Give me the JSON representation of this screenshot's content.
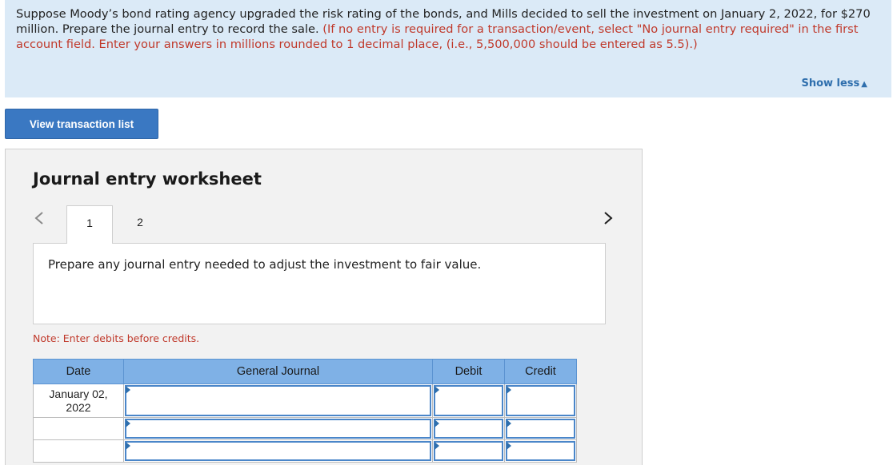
{
  "banner": {
    "text_main": "Suppose Moody’s bond rating agency upgraded the risk rating of the bonds, and Mills decided to sell the investment on January 2, 2022, for $270 million. Prepare the journal entry to record the sale. ",
    "text_instruction": "(If no entry is required for a transaction/event, select \"No journal entry required\" in the first account field. Enter your answers in millions rounded to 1 decimal place, (i.e., 5,500,000 should be entered as 5.5).)",
    "show_less_label": "Show less",
    "show_less_icon": "triangle-up-icon"
  },
  "buttons": {
    "view_transaction_list": "View transaction list"
  },
  "worksheet": {
    "title": "Journal entry worksheet",
    "tabs": [
      {
        "label": "1",
        "active": true
      },
      {
        "label": "2",
        "active": false
      }
    ],
    "prompt": "Prepare any journal entry needed to adjust the investment to fair value.",
    "note": "Note: Enter debits before credits.",
    "table": {
      "headers": [
        "Date",
        "General Journal",
        "Debit",
        "Credit"
      ],
      "rows": [
        {
          "date": "January 02, 2022",
          "account": "",
          "debit": "",
          "credit": ""
        },
        {
          "date": "",
          "account": "",
          "debit": "",
          "credit": ""
        },
        {
          "date": "",
          "account": "",
          "debit": "",
          "credit": ""
        }
      ]
    }
  },
  "colors": {
    "banner_bg": "#dbeaf7",
    "instruction_red": "#c0392b",
    "button_blue": "#3a78c2",
    "table_header_blue": "#7fb1e6"
  }
}
